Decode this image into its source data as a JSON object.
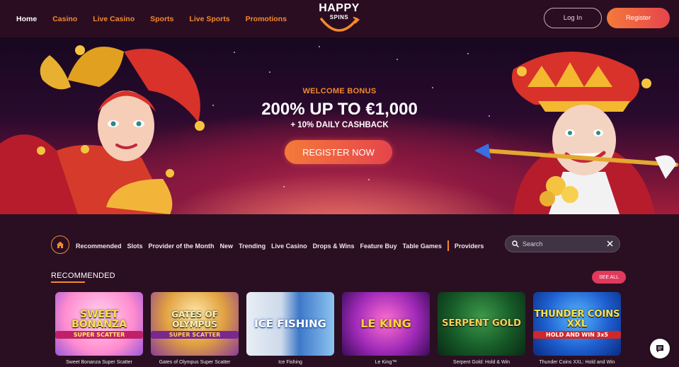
{
  "header": {
    "nav": [
      {
        "label": "Home",
        "active": true
      },
      {
        "label": "Casino"
      },
      {
        "label": "Live Casino"
      },
      {
        "label": "Sports"
      },
      {
        "label": "Live Sports"
      },
      {
        "label": "Promotions"
      }
    ],
    "logo_line1": "HAPPY",
    "logo_line2": "SPINS",
    "login_label": "Log In",
    "register_label": "Register"
  },
  "hero": {
    "welcome": "WELCOME BONUS",
    "headline": "200% UP TO €1,000",
    "cashback": "+ 10% DAILY CASHBACK",
    "cta": "REGISTER NOW"
  },
  "categories": {
    "items": [
      "Recommended",
      "Slots",
      "Provider of the Month",
      "New",
      "Trending",
      "Live Casino",
      "Drops & Wins",
      "Feature Buy",
      "Table Games"
    ],
    "providers_label": "Providers"
  },
  "search": {
    "placeholder": "Search"
  },
  "recommended": {
    "title": "RECOMMENDED",
    "see_all": "SEE ALL",
    "games": [
      {
        "caption": "Sweet Bonanza Super Scatter",
        "art_main": "SWEET BONANZA",
        "art_sub": "SUPER SCATTER"
      },
      {
        "caption": "Gates of Olympus Super Scatter",
        "art_main": "GATES OF OLYMPUS",
        "art_sub": "SUPER SCATTER"
      },
      {
        "caption": "Ice Fishing",
        "art_main": "ICE FISHING",
        "art_sub": ""
      },
      {
        "caption": "Le King™",
        "art_main": "LE KING",
        "art_sub": ""
      },
      {
        "caption": "Serpent Gold: Hold & Win",
        "art_main": "SERPENT GOLD",
        "art_sub": ""
      },
      {
        "caption": "Thunder Coins XXL: Hold and Win",
        "art_main": "THUNDER COINS XXL",
        "art_sub": "HOLD AND WIN 3x5"
      }
    ]
  },
  "colors": {
    "accent_orange": "#f28a2c",
    "cta_start": "#f47a3a",
    "cta_end": "#e6444c",
    "header_bg": "#2b0d22",
    "page_bg": "#2a0f22"
  },
  "icons": [
    "home-icon",
    "search-icon",
    "close-icon",
    "chat-icon",
    "logo-smile-icon"
  ]
}
